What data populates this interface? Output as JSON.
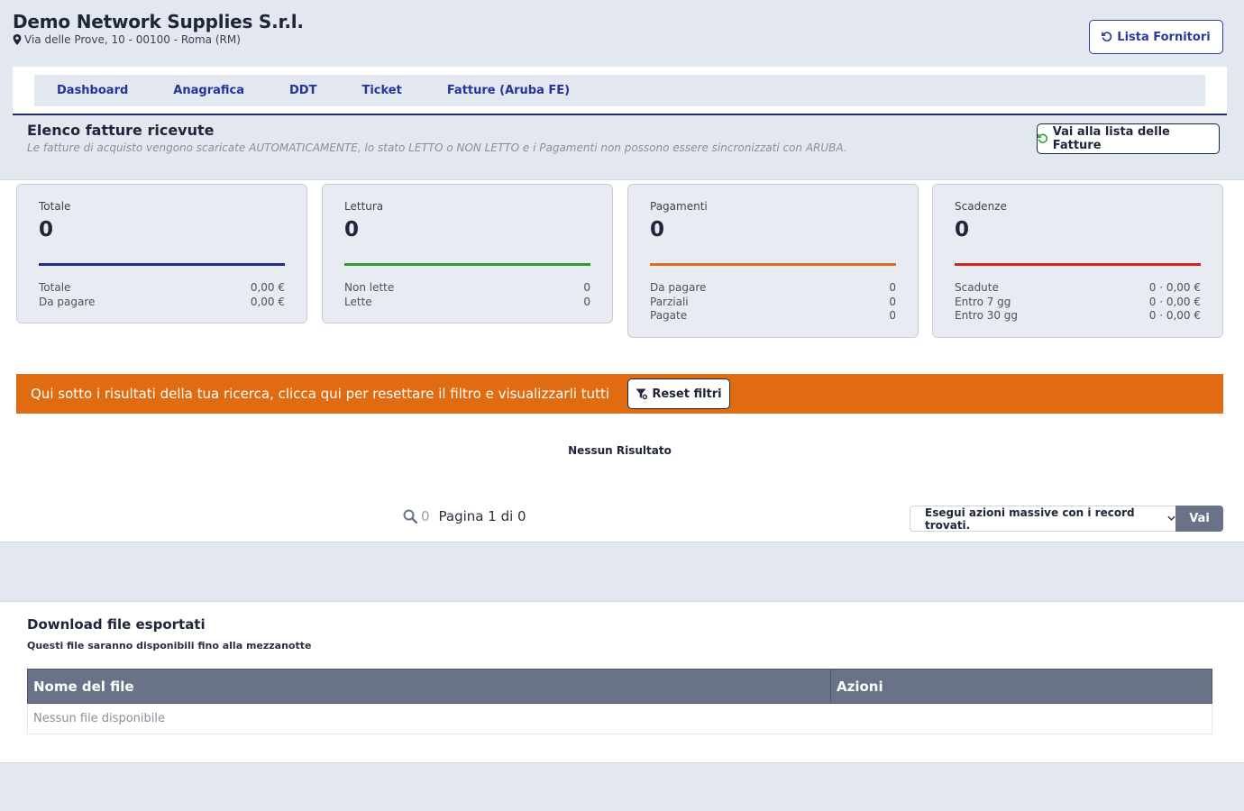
{
  "header": {
    "company_name": "Demo Network Supplies S.r.l.",
    "address": "Via delle Prove, 10 - 00100 - Roma (RM)",
    "fornitori_button": "Lista Fornitori"
  },
  "nav": {
    "tabs": [
      "Dashboard",
      "Anagrafica",
      "DDT",
      "Ticket",
      "Fatture (Aruba FE)"
    ]
  },
  "section": {
    "title": "Elenco fatture ricevute",
    "subtitle": "Le fatture di acquisto vengono scaricate AUTOMATICAMENTE, lo stato LETTO o NON LETTO e i Pagamenti non possono essere sincronizzati con ARUBA.",
    "fatture_button": "Vai alla lista delle Fatture"
  },
  "cards": [
    {
      "title": "Totale",
      "value": "0",
      "color": "#1e2c8e",
      "rows": [
        {
          "label": "Totale",
          "value": "0,00 €"
        },
        {
          "label": "Da pagare",
          "value": "0,00 €"
        }
      ]
    },
    {
      "title": "Lettura",
      "value": "0",
      "color": "#2f9b2f",
      "rows": [
        {
          "label": "Non lette",
          "value": "0"
        },
        {
          "label": "Lette",
          "value": "0"
        }
      ]
    },
    {
      "title": "Pagamenti",
      "value": "0",
      "color": "#dd6a1e",
      "rows": [
        {
          "label": "Da pagare",
          "value": "0"
        },
        {
          "label": "Parziali",
          "value": "0"
        },
        {
          "label": "Pagate",
          "value": "0"
        }
      ]
    },
    {
      "title": "Scadenze",
      "value": "0",
      "color": "#c92a1c",
      "rows": [
        {
          "label": "Scadute",
          "value": "0 · 0,00 €"
        },
        {
          "label": "Entro 7 gg",
          "value": "0 · 0,00 €"
        },
        {
          "label": "Entro 30 gg",
          "value": "0 · 0,00 €"
        }
      ]
    }
  ],
  "banner": {
    "text": "Qui sotto i risultati della tua ricerca, clicca qui per resettare il filtro e visualizzarli tutti",
    "reset_button": "Reset filtri",
    "color": "#e06b10"
  },
  "results": {
    "empty_text": "Nessun Risultato",
    "count": "0",
    "pagination": "Pagina 1 di 0",
    "bulk_select": "Esegui azioni massive con i record trovati.",
    "go_button": "Vai"
  },
  "downloads": {
    "title": "Download file esportati",
    "subtitle": "Questi file saranno disponibili fino alla mezzanotte",
    "columns": [
      "Nome del file",
      "Azioni"
    ],
    "empty_text": "Nessun file disponibile"
  }
}
